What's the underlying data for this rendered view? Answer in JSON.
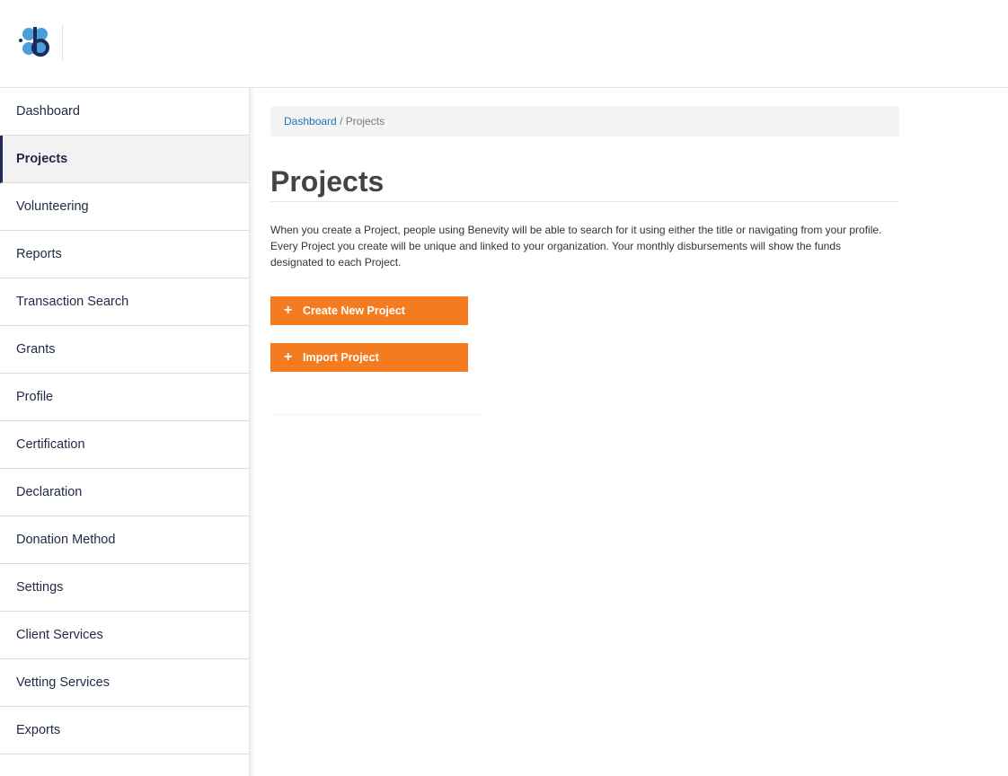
{
  "header": {
    "logo_icon": "benevity-logo-icon",
    "logo_colors": {
      "light": "#4a9fd8",
      "dark": "#1d2a5c"
    }
  },
  "sidebar": {
    "items": [
      {
        "label": "Dashboard",
        "active": false
      },
      {
        "label": "Projects",
        "active": true
      },
      {
        "label": "Volunteering",
        "active": false
      },
      {
        "label": "Reports",
        "active": false
      },
      {
        "label": "Transaction Search",
        "active": false
      },
      {
        "label": "Grants",
        "active": false
      },
      {
        "label": "Profile",
        "active": false
      },
      {
        "label": "Certification",
        "active": false
      },
      {
        "label": "Declaration",
        "active": false
      },
      {
        "label": "Donation Method",
        "active": false
      },
      {
        "label": "Settings",
        "active": false
      },
      {
        "label": "Client Services",
        "active": false
      },
      {
        "label": "Vetting Services",
        "active": false
      },
      {
        "label": "Exports",
        "active": false
      }
    ]
  },
  "breadcrumb": {
    "link": "Dashboard",
    "separator": "/",
    "current": "Projects"
  },
  "main": {
    "title": "Projects",
    "description": "When you create a Project, people using Benevity will be able to search for it using either the title or navigating from your profile. Every Project you create will be unique and linked to your organization. Your monthly disbursements will show the funds designated to each Project.",
    "buttons": {
      "create": "Create New Project",
      "import": "Import Project",
      "icon_glyph": "+"
    }
  },
  "colors": {
    "accent": "#f47b20",
    "link": "#1a76b6",
    "nav_text": "#1f2a44"
  }
}
